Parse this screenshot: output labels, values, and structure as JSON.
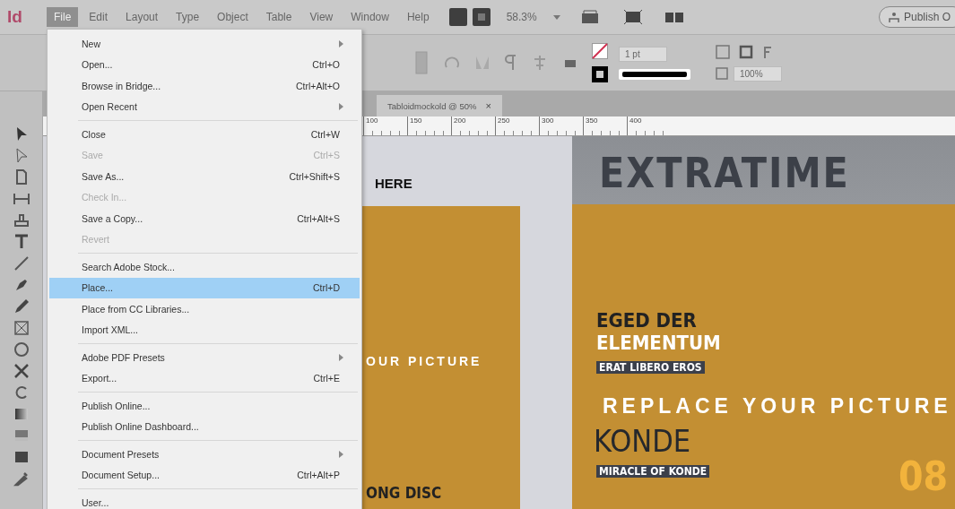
{
  "app": {
    "logo": "Id"
  },
  "menubar": [
    {
      "label": "File",
      "selected": true
    },
    {
      "label": "Edit",
      "selected": false
    },
    {
      "label": "Layout",
      "selected": false
    },
    {
      "label": "Type",
      "selected": false
    },
    {
      "label": "Object",
      "selected": false
    },
    {
      "label": "Table",
      "selected": false
    },
    {
      "label": "View",
      "selected": false
    },
    {
      "label": "Window",
      "selected": false
    },
    {
      "label": "Help",
      "selected": false
    }
  ],
  "top_toolbar": {
    "zoom": "58.3%",
    "publish_button": "Publish O"
  },
  "control_panel": {
    "stroke_weight": "1 pt",
    "opacity": "100%"
  },
  "document_tab": {
    "title": "Tabloidmockold @ 50%",
    "close": "×"
  },
  "ruler": [
    "100",
    "150",
    "200",
    "250",
    "300",
    "350",
    "400"
  ],
  "file_menu": {
    "groups": [
      [
        {
          "label": "New",
          "submenu": true,
          "disabled": false,
          "selected": false
        },
        {
          "label": "Open...",
          "shortcut": "Ctrl+O",
          "submenu": false,
          "disabled": false,
          "selected": false
        },
        {
          "label": "Browse in Bridge...",
          "shortcut": "Ctrl+Alt+O",
          "submenu": false,
          "disabled": false,
          "selected": false
        },
        {
          "label": "Open Recent",
          "submenu": true,
          "disabled": false,
          "selected": false
        }
      ],
      [
        {
          "label": "Close",
          "shortcut": "Ctrl+W",
          "submenu": false,
          "disabled": false,
          "selected": false
        },
        {
          "label": "Save",
          "shortcut": "Ctrl+S",
          "submenu": false,
          "disabled": true,
          "selected": false
        },
        {
          "label": "Save As...",
          "shortcut": "Ctrl+Shift+S",
          "submenu": false,
          "disabled": false,
          "selected": false
        },
        {
          "label": "Check In...",
          "submenu": false,
          "disabled": true,
          "selected": false
        },
        {
          "label": "Save a Copy...",
          "shortcut": "Ctrl+Alt+S",
          "submenu": false,
          "disabled": false,
          "selected": false
        },
        {
          "label": "Revert",
          "submenu": false,
          "disabled": true,
          "selected": false
        }
      ],
      [
        {
          "label": "Search Adobe Stock...",
          "submenu": false,
          "disabled": false,
          "selected": false
        },
        {
          "label": "Place...",
          "shortcut": "Ctrl+D",
          "submenu": false,
          "disabled": false,
          "selected": true
        },
        {
          "label": "Place from CC Libraries...",
          "submenu": false,
          "disabled": false,
          "selected": false
        },
        {
          "label": "Import XML...",
          "submenu": false,
          "disabled": false,
          "selected": false
        }
      ],
      [
        {
          "label": "Adobe PDF Presets",
          "submenu": true,
          "disabled": false,
          "selected": false
        },
        {
          "label": "Export...",
          "shortcut": "Ctrl+E",
          "submenu": false,
          "disabled": false,
          "selected": false
        }
      ],
      [
        {
          "label": "Publish Online...",
          "submenu": false,
          "disabled": false,
          "selected": false
        },
        {
          "label": "Publish Online Dashboard...",
          "submenu": false,
          "disabled": false,
          "selected": false
        }
      ],
      [
        {
          "label": "Document Presets",
          "submenu": true,
          "disabled": false,
          "selected": false
        },
        {
          "label": "Document Setup...",
          "shortcut": "Ctrl+Alt+P",
          "submenu": false,
          "disabled": false,
          "selected": false
        }
      ],
      [
        {
          "label": "User...",
          "submenu": false,
          "disabled": false,
          "selected": false
        }
      ]
    ]
  },
  "canvas": {
    "left_page": {
      "heading": "HERE",
      "picture_text": "OUR PICTURE",
      "bottom_text": "ONG DISC"
    },
    "right_page": {
      "masthead": "EXTRATIME",
      "headline_1": "EGED DER",
      "headline_2": "ELEMENTUM",
      "tag_1": "ERAT LIBERO EROS",
      "picture_text": "REPLACE YOUR PICTURE",
      "big_word": "KONDE",
      "tag_2": "MIRACLE OF KONDE",
      "page_number": "08"
    }
  }
}
